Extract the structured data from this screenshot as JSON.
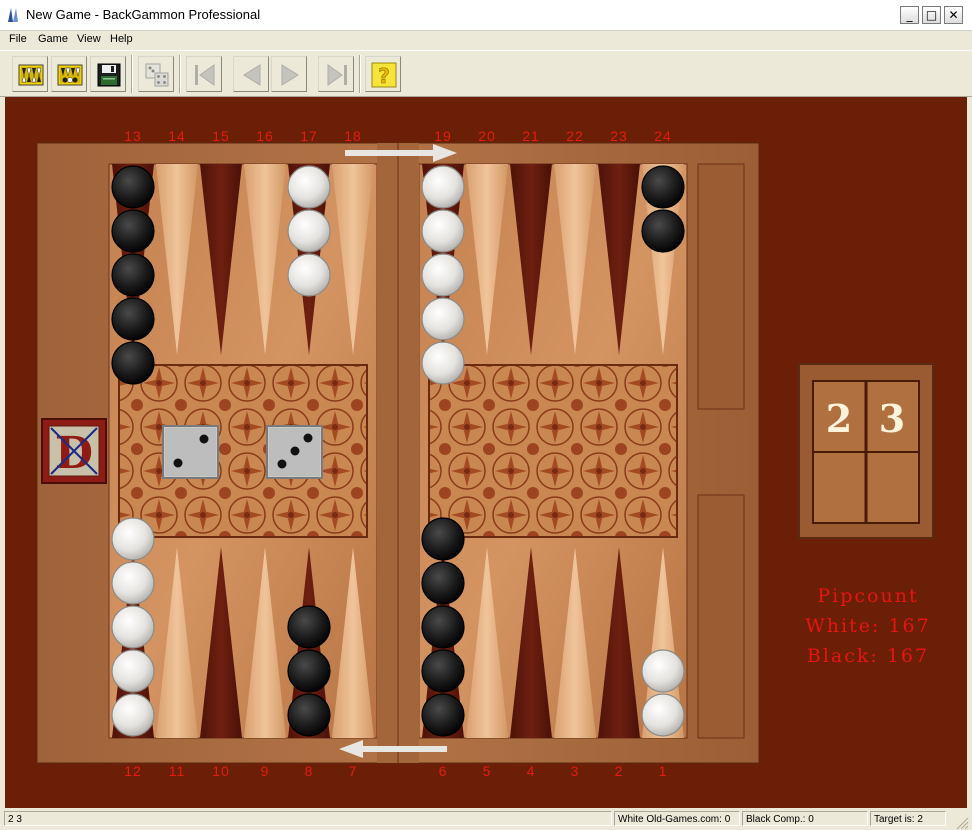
{
  "window": {
    "title": "New Game - BackGammon Professional",
    "minimize": "_",
    "maximize": "□",
    "close": "✕"
  },
  "menu": [
    "File",
    "Game",
    "View",
    "Help"
  ],
  "toolbar": {
    "buttons": [
      {
        "name": "new-game-button",
        "icon": "new-game-icon",
        "enabled": true
      },
      {
        "name": "open-game-button",
        "icon": "open-game-icon",
        "enabled": true
      },
      {
        "name": "save-button",
        "icon": "floppy-disk-icon",
        "enabled": true
      },
      {
        "name": "roll-dice-button",
        "icon": "dice-icon",
        "enabled": false
      },
      {
        "name": "first-move-button",
        "icon": "first-icon",
        "enabled": false
      },
      {
        "name": "previous-move-button",
        "icon": "previous-icon",
        "enabled": false
      },
      {
        "name": "next-move-button",
        "icon": "next-icon",
        "enabled": false
      },
      {
        "name": "last-move-button",
        "icon": "last-icon",
        "enabled": false
      },
      {
        "name": "help-button",
        "icon": "question-icon",
        "enabled": true
      }
    ]
  },
  "board": {
    "top_points": [
      "13",
      "14",
      "15",
      "16",
      "17",
      "18",
      "19",
      "20",
      "21",
      "22",
      "23",
      "24"
    ],
    "bottom_points": [
      "12",
      "11",
      "10",
      "9",
      "8",
      "7",
      "6",
      "5",
      "4",
      "3",
      "2",
      "1"
    ],
    "checkers": [
      {
        "point": 13,
        "color": "black",
        "count": 5
      },
      {
        "point": 17,
        "color": "white",
        "count": 3
      },
      {
        "point": 19,
        "color": "white",
        "count": 5
      },
      {
        "point": 24,
        "color": "black",
        "count": 2
      },
      {
        "point": 12,
        "color": "white",
        "count": 5
      },
      {
        "point": 8,
        "color": "black",
        "count": 3
      },
      {
        "point": 6,
        "color": "black",
        "count": 5
      },
      {
        "point": 1,
        "color": "white",
        "count": 2
      }
    ],
    "dice": [
      2,
      3
    ],
    "doubling_cube": "D"
  },
  "side_dice": {
    "die1": "2",
    "die2": "3"
  },
  "pipcount": {
    "title": "Pipcount",
    "white": "White: 167",
    "black": "Black: 167"
  },
  "status": {
    "dice": "2 3",
    "white": "White Old-Games.com: 0",
    "black": "Black Comp.: 0",
    "target": "Target is: 2"
  },
  "colors": {
    "background": "#6b1f07",
    "wood": "#a86a3e",
    "point_light": "#e8b488",
    "point_dark": "#5a160c",
    "text_red": "#e61c10"
  }
}
